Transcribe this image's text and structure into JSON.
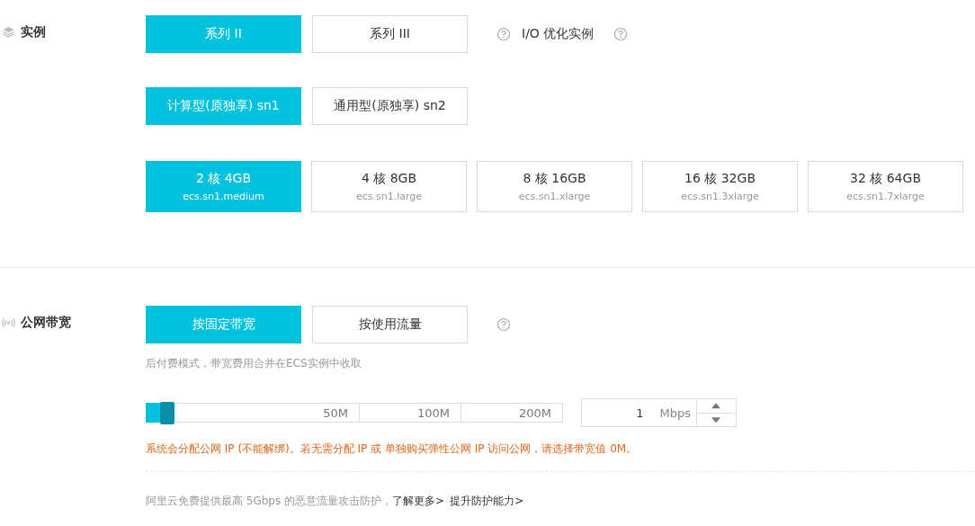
{
  "instance": {
    "label": "实例",
    "series": [
      {
        "label": "系列 II",
        "selected": true
      },
      {
        "label": "系列 III",
        "selected": false
      }
    ],
    "io_label": "I/O 优化实例",
    "families": [
      {
        "label": "计算型(原独享) sn1",
        "selected": true
      },
      {
        "label": "通用型(原独享) sn2",
        "selected": false
      }
    ],
    "specs": [
      {
        "size": "2 核 4GB",
        "code": "ecs.sn1.medium",
        "selected": true
      },
      {
        "size": "4 核 8GB",
        "code": "ecs.sn1.large",
        "selected": false
      },
      {
        "size": "8 核 16GB",
        "code": "ecs.sn1.xlarge",
        "selected": false
      },
      {
        "size": "16 核 32GB",
        "code": "ecs.sn1.3xlarge",
        "selected": false
      },
      {
        "size": "32 核 64GB",
        "code": "ecs.sn1.7xlarge",
        "selected": false
      }
    ]
  },
  "bandwidth": {
    "label": "公网带宽",
    "modes": [
      {
        "label": "按固定带宽",
        "selected": true
      },
      {
        "label": "按使用流量",
        "selected": false
      }
    ],
    "note": "后付费模式，带宽费用合并在ECS实例中收取",
    "slider": {
      "level": 0.05,
      "marks": [
        "50M",
        "100M",
        "200M"
      ]
    },
    "value": "1",
    "unit": "Mbps",
    "warning": "系统会分配公网 IP (不能解绑)。若无需分配 IP 或 单独购买弹性公网 IP 访问公网，请选择带宽值 0M。",
    "protection": {
      "text": "阿里云免费提供最高 5Gbps 的恶意流量攻击防护，",
      "links": [
        "了解更多>",
        "提升防护能力>"
      ]
    }
  }
}
